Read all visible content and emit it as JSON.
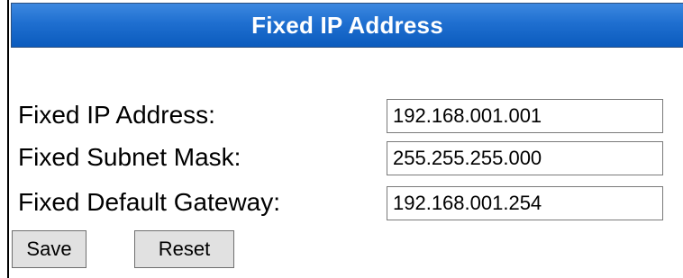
{
  "panel": {
    "title": "Fixed IP Address"
  },
  "fields": [
    {
      "label": "Fixed IP Address:",
      "value": "192.168.001.001"
    },
    {
      "label": "Fixed Subnet Mask:",
      "value": "255.255.255.000"
    },
    {
      "label": "Fixed Default Gateway:",
      "value": "192.168.001.254"
    }
  ],
  "buttons": {
    "save_label": "Save",
    "reset_label": "Reset"
  },
  "colors": {
    "title_bar": "#1f6fd0",
    "title_text": "#ffffff",
    "button_bg": "#e1e1e1"
  }
}
